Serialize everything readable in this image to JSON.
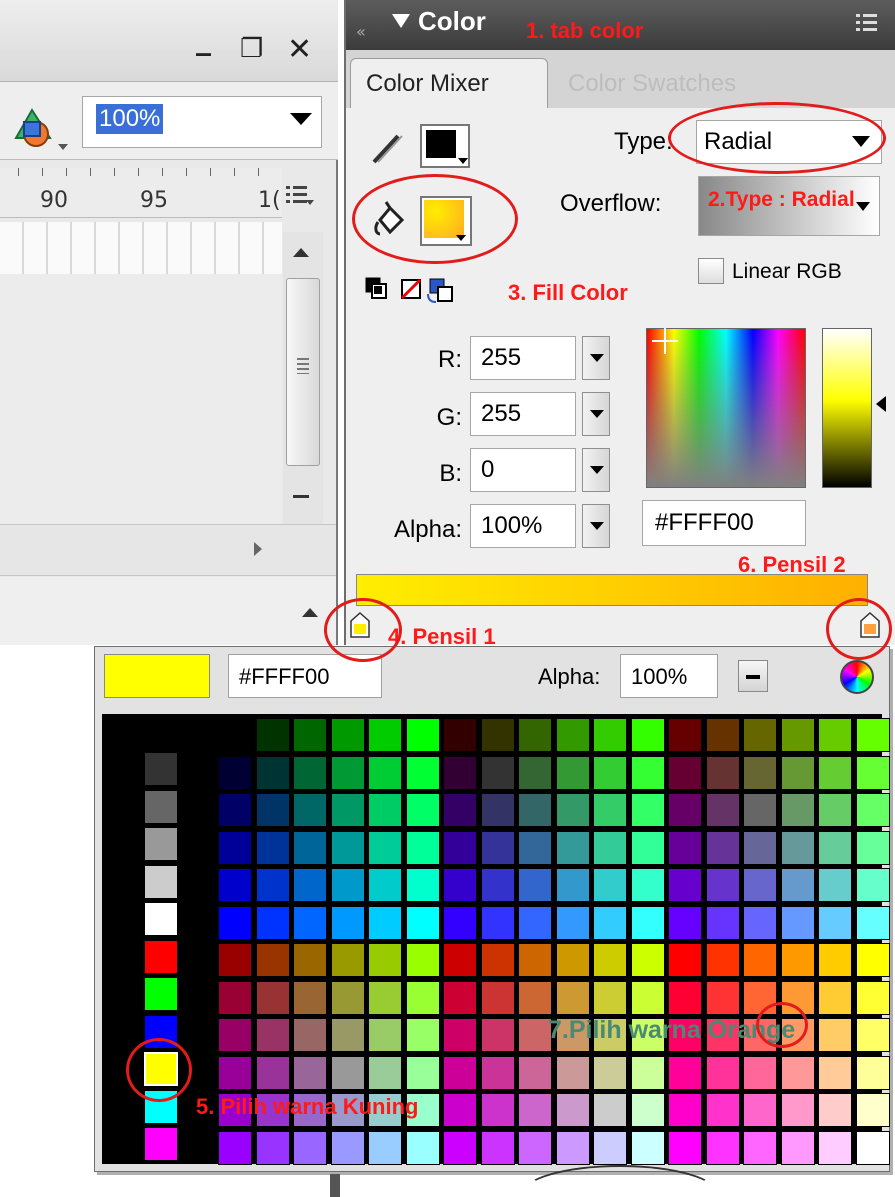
{
  "left_panel": {
    "window_controls": {
      "minimize": "_",
      "restore": "❐",
      "close": "✕"
    },
    "zoom": {
      "value": "100%"
    },
    "ruler_numbers": [
      "90",
      "95",
      "1("
    ]
  },
  "color_panel": {
    "title": "Color",
    "tabs": [
      {
        "label": "Color Mixer",
        "active": true
      },
      {
        "label": "Color Swatches",
        "active": false
      }
    ],
    "stroke_color": "#000000",
    "fill_colors": [
      "#ffee00",
      "#ffaa22"
    ],
    "type": {
      "label": "Type:",
      "value": "Radial"
    },
    "overflow": {
      "label": "Overflow:"
    },
    "linear_rgb": {
      "label": "Linear RGB",
      "checked": false
    },
    "channels": [
      {
        "label": "R:",
        "value": "255"
      },
      {
        "label": "G:",
        "value": "255"
      },
      {
        "label": "B:",
        "value": "0"
      },
      {
        "label": "Alpha:",
        "value": "100%"
      }
    ],
    "hex": "#FFFF00",
    "gradient": {
      "start": "#ffee00",
      "end": "#ffb000"
    }
  },
  "swatch_popup": {
    "preview_color": "#FFFF00",
    "hex": "#FFFF00",
    "alpha_label": "Alpha:",
    "alpha_value": "100%",
    "side_colors": [
      "#333333",
      "#666666",
      "#999999",
      "#cccccc",
      "#ffffff",
      "#ff0000",
      "#00ff00",
      "#0000ff",
      "#ffff00",
      "#00ffff",
      "#ff00ff"
    ],
    "selected_side_color": "#ffff00",
    "web_palette_levels": [
      "00",
      "33",
      "66",
      "99",
      "cc",
      "ff"
    ]
  },
  "annotations": {
    "tab_color": "1. tab color",
    "type_radial": "2.Type : Radial",
    "fill_color": "3. Fill Color",
    "pensil_1": "4. Pensil 1",
    "pilih_kuning": "5. Pilih warna Kuning",
    "pensil_2": "6. Pensil 2",
    "pilih_orange": "7.Pilih warna Orange"
  }
}
